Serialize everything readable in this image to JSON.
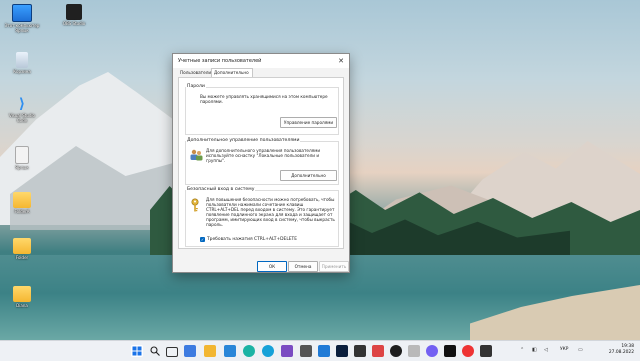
{
  "desktop": {
    "icons": [
      {
        "label": "Этот компьютер Ярлык"
      },
      {
        "label": "OBS Studio"
      },
      {
        "label": "Корзина"
      },
      {
        "label": "Visual Studio Code"
      },
      {
        "label": "Ярлык"
      },
      {
        "label": "FolderA"
      },
      {
        "label": "Folder"
      },
      {
        "label": "Diana"
      }
    ]
  },
  "dialog": {
    "title": "Учетные записи пользователей",
    "close_glyph": "✕",
    "tabs": [
      {
        "label": "Пользователи"
      },
      {
        "label": "Дополнительно"
      }
    ],
    "group_passwords": {
      "title": "Пароли",
      "text": "Вы можете управлять хранящимися на этом компьютере паролями.",
      "button": "Управление паролями"
    },
    "group_advanced": {
      "title": "Дополнительное управление пользователями",
      "text": "Для дополнительного управления пользователями используйте оснастку \"Локальные пользователи и группы\".",
      "button": "Дополнительно"
    },
    "group_secure": {
      "title": "Безопасный вход в систему",
      "text": "Для повышения безопасности можно потребовать, чтобы пользователи нажимали сочетание клавиш CTRL+ALT+DEL перед входом в систему. Это гарантирует появление подлинного экрана для входа и защищает от программ, имитирующих вход в систему, чтобы выкрасть пароль.",
      "checkbox_label": "Требовать нажатия CTRL+ALT+DELETE",
      "checkbox_checked": true
    },
    "buttons": {
      "ok": "ОК",
      "cancel": "Отмена",
      "apply": "Применить"
    }
  },
  "taskbar": {
    "lang": "УКР",
    "time": "19:38",
    "date": "27.08.2022",
    "icons": [
      "windows-icon",
      "search-icon",
      "task-view-icon",
      "widgets-icon",
      "file-explorer-icon",
      "chrome-icon",
      "edge-icon",
      "vs-icon",
      "app-icon",
      "store-icon",
      "photoshop-icon",
      "obs-icon",
      "app2-icon",
      "viber-icon",
      "app3-icon",
      "app4-icon",
      "app5-icon",
      "app6-icon",
      "app7-icon"
    ]
  }
}
